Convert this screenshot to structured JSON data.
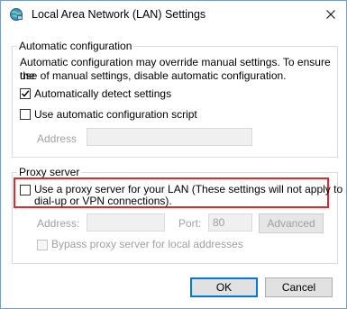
{
  "window": {
    "title": "Local Area Network (LAN) Settings"
  },
  "automatic_configuration": {
    "group_label": "Automatic configuration",
    "description_line1": "Automatic configuration may override manual settings.  To ensure the",
    "description_line2": "use of manual settings, disable automatic configuration.",
    "auto_detect": {
      "label": "Automatically detect settings",
      "checked": true
    },
    "auto_script": {
      "label": "Use automatic configuration script",
      "checked": false
    },
    "address_label": "Address",
    "address_value": ""
  },
  "proxy_server": {
    "group_label": "Proxy server",
    "use_proxy": {
      "label_line1": "Use a proxy server for your LAN (These settings will not apply to",
      "label_line2": "dial-up or VPN connections).",
      "checked": false
    },
    "address_label": "Address:",
    "address_value": "",
    "port_label": "Port:",
    "port_value": "80",
    "advanced_label": "Advanced",
    "bypass_label": "Bypass proxy server for local addresses",
    "bypass_checked": false
  },
  "buttons": {
    "ok": "OK",
    "cancel": "Cancel"
  },
  "colors": {
    "highlight": "#e0282e",
    "primary_border": "#0078d7"
  }
}
